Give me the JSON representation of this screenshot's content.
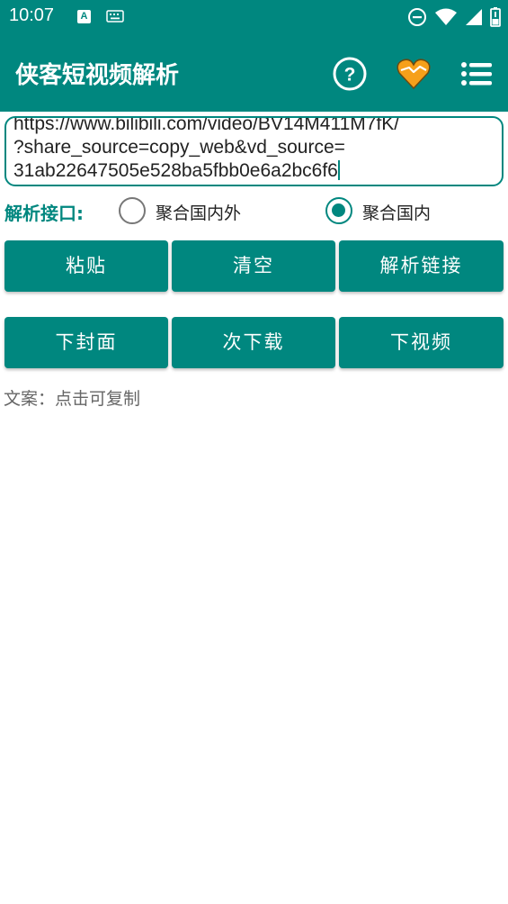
{
  "status_bar": {
    "time": "10:07",
    "notification_letter": "A",
    "icons": [
      "notification-a-icon",
      "keyboard-icon",
      "do-not-disturb-icon",
      "wifi-icon",
      "signal-icon",
      "battery-icon"
    ]
  },
  "app_bar": {
    "title": "侠客短视频解析",
    "help_icon": "help-icon",
    "favorite_icon": "heart-icon",
    "menu_icon": "menu-list-icon",
    "colors": {
      "primary": "#00877f",
      "heart": "#f6a01a"
    }
  },
  "url_input": {
    "value": "https://www.bilibili.com/video/BV14M411M7fK/\n?share_source=copy_web&vd_source=\n31ab22647505e528ba5fbb0e6a2bc6f6"
  },
  "api_selector": {
    "label": "解析接口:",
    "options": [
      {
        "label": "聚合国内外",
        "selected": false
      },
      {
        "label": "聚合国内",
        "selected": true
      }
    ]
  },
  "buttons_row1": {
    "paste": "粘贴",
    "clear": "清空",
    "parse": "解析链接"
  },
  "buttons_row2": {
    "cover": "下封面",
    "next_download": "次下载",
    "video": "下视频"
  },
  "caption": "文案：点击可复制"
}
